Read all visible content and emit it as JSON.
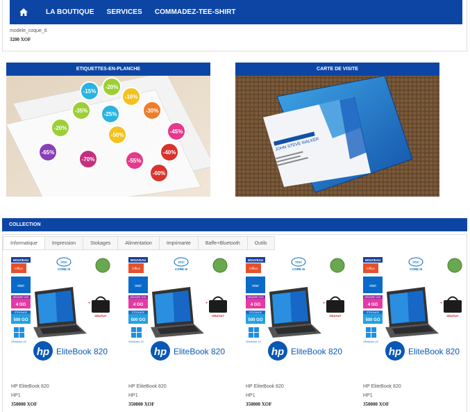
{
  "nav": {
    "items": [
      {
        "label": "LA BOUTIQUE"
      },
      {
        "label": "SERVICES"
      },
      {
        "label": "COMMADEZ-TEE-SHIRT"
      }
    ]
  },
  "top_product": {
    "name": "modele_coque_6",
    "price": "3200 XOF"
  },
  "banners": [
    {
      "title": "ETIQUETTES-EN-PLANCHE",
      "labels": [
        "-15%",
        "-20%",
        "-10%",
        "-30%",
        "-45%",
        "-25%",
        "-40%",
        "-50%",
        "-35%",
        "-70%",
        "-55%",
        "-60%",
        "-20%",
        "-65%"
      ]
    },
    {
      "title": "CARTE DE VISITE",
      "card_name": "JOHN STEVE WALKER"
    }
  ],
  "collection": {
    "title": "COLLECTION",
    "tabs": [
      "Informatique",
      "Impression",
      "Stokages",
      "Alimentation",
      "Imprimante",
      "Baffe+Bluetooth",
      "Outils"
    ],
    "ad": {
      "nouveau": "NOUVEAU",
      "office": "Office",
      "intel": "intel",
      "core": "CORE i5",
      "memory_label": "MÉMOIRE VIVE",
      "memory": "4 GO",
      "storage_label": "STOCKAGE",
      "storage": "500 GO",
      "windows": "Windows 10",
      "gratuit": "GRATUIT",
      "model": "EliteBook 820"
    },
    "products": [
      {
        "name": "HP EliteBook 820",
        "brand": "HP1",
        "price": "350000 XOF"
      },
      {
        "name": "HP EliteBook 820",
        "brand": "HP1",
        "price": "350000 XOF"
      },
      {
        "name": "HP EliteBook 820",
        "brand": "HP1",
        "price": "350000 XOF"
      },
      {
        "name": "HP EliteBook 820",
        "brand": "HP1",
        "price": "350000 XOF"
      }
    ]
  },
  "colors": {
    "brand_blue": "#0d45a5"
  }
}
